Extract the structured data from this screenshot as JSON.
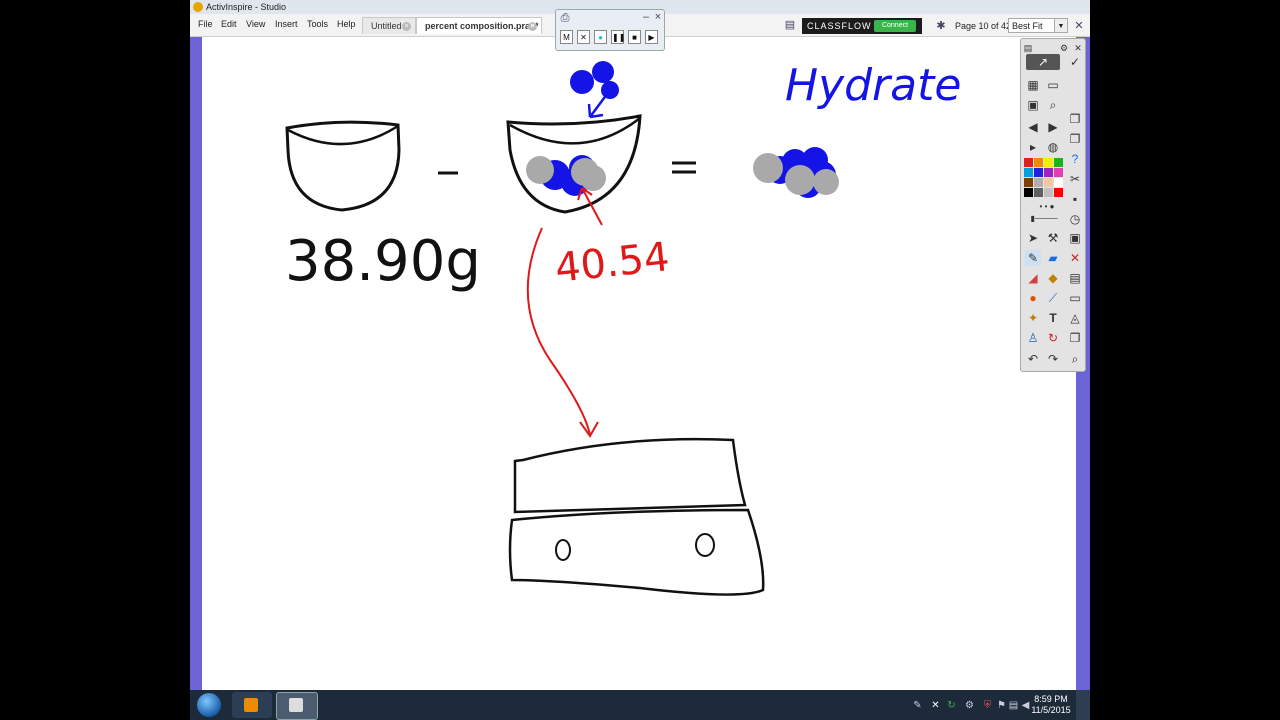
{
  "window": {
    "title": "ActivInspire - Studio"
  },
  "menu": [
    "File",
    "Edit",
    "View",
    "Insert",
    "Tools",
    "Help"
  ],
  "tabs": [
    {
      "label": "Untitled",
      "active": false
    },
    {
      "label": "percent composition.prac*",
      "active": true
    }
  ],
  "classflow": {
    "logo": "CLASSFLOW",
    "connect": "Connect"
  },
  "page_indicator": "Page 10 of 42",
  "zoom": "Best Fit",
  "recorder": {
    "buttons": [
      "M",
      "✕",
      "●",
      "❚❚",
      "■",
      "▶"
    ]
  },
  "canvas": {
    "heading": "Hydrate",
    "mass_label": "38.90g",
    "mass2_label": "40.54",
    "minus": "-",
    "equals": "=",
    "colors": {
      "ink": "#111111",
      "red": "#e01818",
      "blue": "#1414e6",
      "grey": "#a9a9a9"
    }
  },
  "toolbox": {
    "palette": [
      "#e02020",
      "#f08c00",
      "#f0f000",
      "#19b419",
      "#00a0e0",
      "#2020e0",
      "#a020c0",
      "#e040b0",
      "#7b3f00",
      "#b0b0b0",
      "#f7c6a5",
      "#ffffff",
      "#000000",
      "#606060",
      "#c0c0c0",
      "#ff0000"
    ]
  },
  "taskbar": {
    "time": "8:59 PM",
    "date": "11/5/2015"
  }
}
